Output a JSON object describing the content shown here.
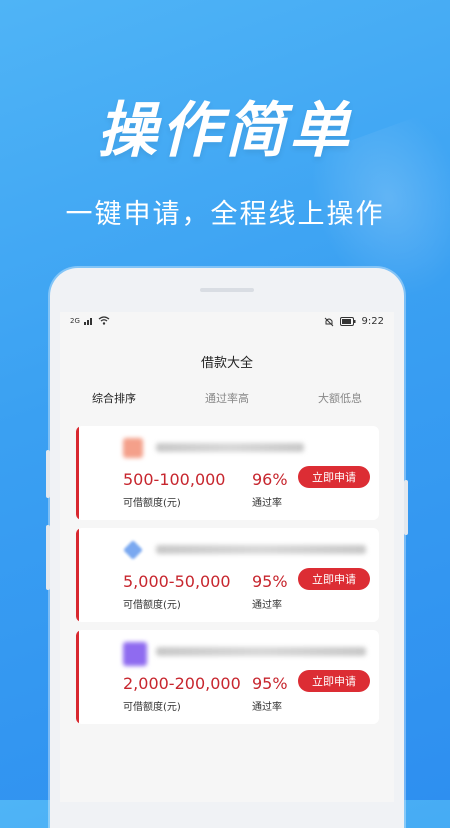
{
  "promo": {
    "headline": "操作简单",
    "subline": "一键申请，全程线上操作"
  },
  "status_bar": {
    "signal": "2G",
    "time": "9:22"
  },
  "app": {
    "title": "借款大全",
    "tabs": [
      {
        "label": "综合排序",
        "active": true
      },
      {
        "label": "通过率高",
        "active": false
      },
      {
        "label": "大额低息",
        "active": false
      }
    ]
  },
  "loans": [
    {
      "logo_color": "#f4a08a",
      "amount": "500-100,000",
      "amount_label": "可借额度(元)",
      "rate": "96%",
      "rate_label": "通过率",
      "apply_label": "立即申请"
    },
    {
      "logo_color": "#7aa8f0",
      "amount": "5,000-50,000",
      "amount_label": "可借额度(元)",
      "rate": "95%",
      "rate_label": "通过率",
      "apply_label": "立即申请"
    },
    {
      "logo_color": "#8f6bf0",
      "amount": "2,000-200,000",
      "amount_label": "可借额度(元)",
      "rate": "95%",
      "rate_label": "通过率",
      "apply_label": "立即申请"
    }
  ],
  "colors": {
    "accent": "#dc2d34",
    "background_blue": "#3aa0f2"
  }
}
